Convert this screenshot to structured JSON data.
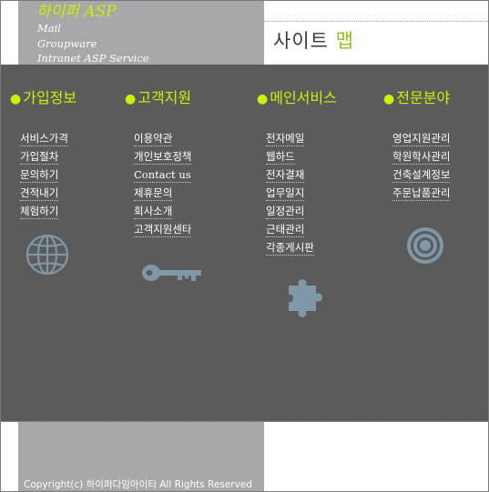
{
  "header": {
    "brand": "하이퍼 ASP",
    "taglines": [
      "Mail",
      "Groupware",
      "Intranet ASP Service"
    ],
    "page_title_a": "사이트 ",
    "page_title_b": "맵"
  },
  "colors": {
    "accent": "#ccf000",
    "title_accent": "#8fc21a",
    "panel": "#5b5b5b",
    "header_gray": "#a9a7aa",
    "icon": "#7f97a6"
  },
  "columns": [
    {
      "title": "가입정보",
      "icon": "globe-icon",
      "links": [
        "서비스가격",
        "가입절차",
        "문의하기",
        "견적내기",
        "체험하기"
      ]
    },
    {
      "title": "고객지원",
      "icon": "key-icon",
      "links": [
        "이용약관",
        "개인보호정책",
        "Contact us",
        "제휴문의",
        "회사소개",
        "고객지원센타"
      ]
    },
    {
      "title": "메인서비스",
      "icon": "puzzle-icon",
      "links": [
        "전자메일",
        "웹하드",
        "전자결재",
        "업무일지",
        "일정관리",
        "근태관리",
        "각종게시판"
      ]
    },
    {
      "title": "전문분야",
      "icon": "target-icon",
      "links": [
        "영업지원관리",
        "학원학사관리",
        "건축설계정보",
        "주문납품관리"
      ]
    }
  ],
  "footer": {
    "copyright": "Copyright(c) 하이퍼다임아이티 All Rights Reserved"
  }
}
